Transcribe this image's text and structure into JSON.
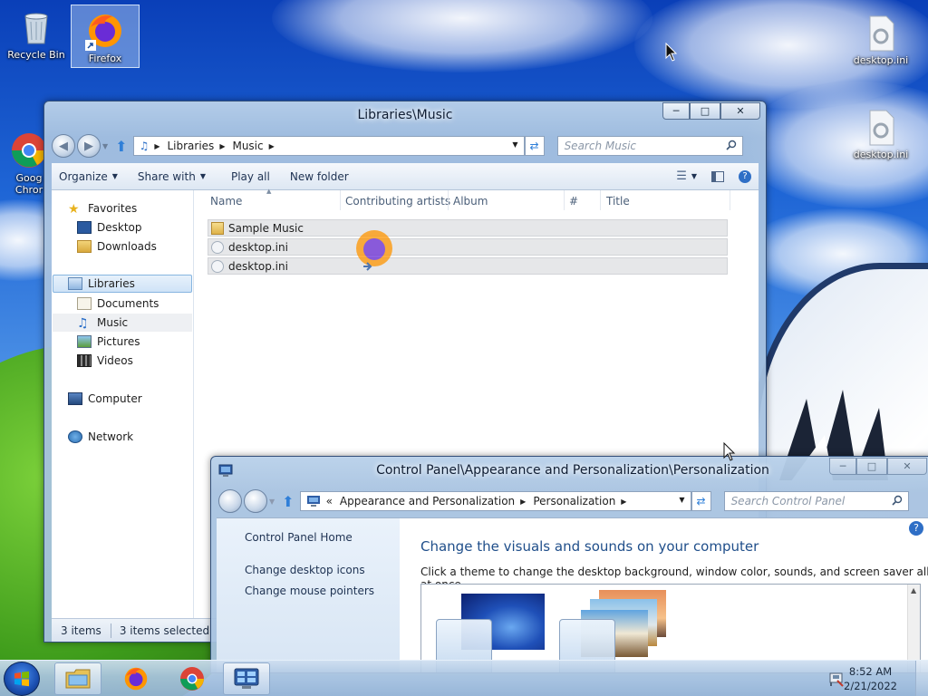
{
  "desktop": {
    "icons": [
      {
        "label": "Recycle Bin"
      },
      {
        "label": "Firefox"
      },
      {
        "label": "Goog\nChror"
      },
      {
        "label": "desktop.ini"
      },
      {
        "label": "desktop.ini"
      }
    ]
  },
  "explorer": {
    "title": "Libraries\\Music",
    "address": {
      "crumbs": [
        "Libraries",
        "Music"
      ]
    },
    "search_placeholder": "Search Music",
    "toolbar": {
      "organize": "Organize",
      "share_with": "Share with",
      "play_all": "Play all",
      "new_folder": "New folder"
    },
    "nav": {
      "favorites": "Favorites",
      "desktop": "Desktop",
      "downloads": "Downloads",
      "libraries": "Libraries",
      "documents": "Documents",
      "music": "Music",
      "pictures": "Pictures",
      "videos": "Videos",
      "computer": "Computer",
      "network": "Network"
    },
    "columns": {
      "name": "Name",
      "contributing_artists": "Contributing artists",
      "album": "Album",
      "number": "#",
      "title": "Title"
    },
    "files": [
      {
        "name": "Sample Music",
        "kind": "folder"
      },
      {
        "name": "desktop.ini",
        "kind": "settings-file"
      },
      {
        "name": "desktop.ini",
        "kind": "settings-file"
      }
    ],
    "status": {
      "items": "3 items",
      "selected": "3 items selected"
    }
  },
  "control_panel": {
    "title": "Control Panel\\Appearance and Personalization\\Personalization",
    "address": {
      "lead": "«",
      "crumbs": [
        "Appearance and Personalization",
        "Personalization"
      ]
    },
    "search_placeholder": "Search Control Panel",
    "sidebar": {
      "home": "Control Panel Home",
      "desktop_icons": "Change desktop icons",
      "mouse_pointers": "Change mouse pointers"
    },
    "heading": "Change the visuals and sounds on your computer",
    "subheading": "Click a theme to change the desktop background, window color, sounds, and screen saver all at once."
  },
  "taskbar": {
    "time": "8:52 AM",
    "date": "2/21/2022"
  },
  "colors": {
    "link": "#1f4e8a",
    "selection": "#cfe3f7"
  }
}
